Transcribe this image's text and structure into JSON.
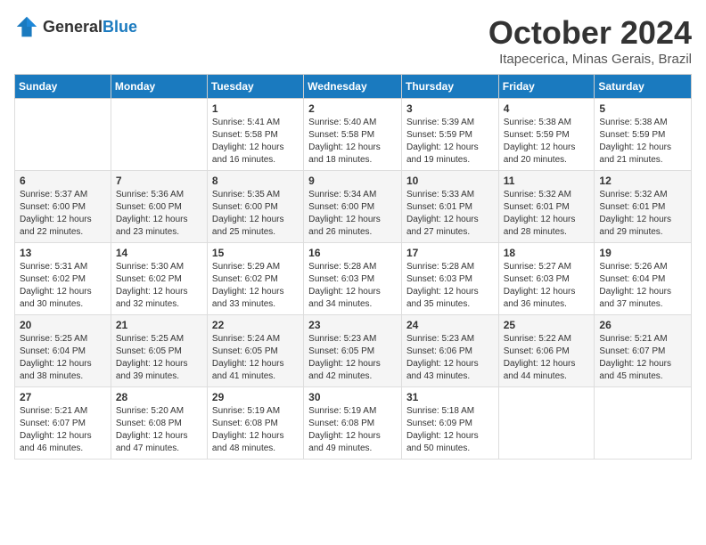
{
  "logo": {
    "general": "General",
    "blue": "Blue"
  },
  "title": "October 2024",
  "location": "Itapecerica, Minas Gerais, Brazil",
  "days_of_week": [
    "Sunday",
    "Monday",
    "Tuesday",
    "Wednesday",
    "Thursday",
    "Friday",
    "Saturday"
  ],
  "weeks": [
    [
      {
        "day": "",
        "sunrise": "",
        "sunset": "",
        "daylight": ""
      },
      {
        "day": "",
        "sunrise": "",
        "sunset": "",
        "daylight": ""
      },
      {
        "day": "1",
        "sunrise": "Sunrise: 5:41 AM",
        "sunset": "Sunset: 5:58 PM",
        "daylight": "Daylight: 12 hours and 16 minutes."
      },
      {
        "day": "2",
        "sunrise": "Sunrise: 5:40 AM",
        "sunset": "Sunset: 5:58 PM",
        "daylight": "Daylight: 12 hours and 18 minutes."
      },
      {
        "day": "3",
        "sunrise": "Sunrise: 5:39 AM",
        "sunset": "Sunset: 5:59 PM",
        "daylight": "Daylight: 12 hours and 19 minutes."
      },
      {
        "day": "4",
        "sunrise": "Sunrise: 5:38 AM",
        "sunset": "Sunset: 5:59 PM",
        "daylight": "Daylight: 12 hours and 20 minutes."
      },
      {
        "day": "5",
        "sunrise": "Sunrise: 5:38 AM",
        "sunset": "Sunset: 5:59 PM",
        "daylight": "Daylight: 12 hours and 21 minutes."
      }
    ],
    [
      {
        "day": "6",
        "sunrise": "Sunrise: 5:37 AM",
        "sunset": "Sunset: 6:00 PM",
        "daylight": "Daylight: 12 hours and 22 minutes."
      },
      {
        "day": "7",
        "sunrise": "Sunrise: 5:36 AM",
        "sunset": "Sunset: 6:00 PM",
        "daylight": "Daylight: 12 hours and 23 minutes."
      },
      {
        "day": "8",
        "sunrise": "Sunrise: 5:35 AM",
        "sunset": "Sunset: 6:00 PM",
        "daylight": "Daylight: 12 hours and 25 minutes."
      },
      {
        "day": "9",
        "sunrise": "Sunrise: 5:34 AM",
        "sunset": "Sunset: 6:00 PM",
        "daylight": "Daylight: 12 hours and 26 minutes."
      },
      {
        "day": "10",
        "sunrise": "Sunrise: 5:33 AM",
        "sunset": "Sunset: 6:01 PM",
        "daylight": "Daylight: 12 hours and 27 minutes."
      },
      {
        "day": "11",
        "sunrise": "Sunrise: 5:32 AM",
        "sunset": "Sunset: 6:01 PM",
        "daylight": "Daylight: 12 hours and 28 minutes."
      },
      {
        "day": "12",
        "sunrise": "Sunrise: 5:32 AM",
        "sunset": "Sunset: 6:01 PM",
        "daylight": "Daylight: 12 hours and 29 minutes."
      }
    ],
    [
      {
        "day": "13",
        "sunrise": "Sunrise: 5:31 AM",
        "sunset": "Sunset: 6:02 PM",
        "daylight": "Daylight: 12 hours and 30 minutes."
      },
      {
        "day": "14",
        "sunrise": "Sunrise: 5:30 AM",
        "sunset": "Sunset: 6:02 PM",
        "daylight": "Daylight: 12 hours and 32 minutes."
      },
      {
        "day": "15",
        "sunrise": "Sunrise: 5:29 AM",
        "sunset": "Sunset: 6:02 PM",
        "daylight": "Daylight: 12 hours and 33 minutes."
      },
      {
        "day": "16",
        "sunrise": "Sunrise: 5:28 AM",
        "sunset": "Sunset: 6:03 PM",
        "daylight": "Daylight: 12 hours and 34 minutes."
      },
      {
        "day": "17",
        "sunrise": "Sunrise: 5:28 AM",
        "sunset": "Sunset: 6:03 PM",
        "daylight": "Daylight: 12 hours and 35 minutes."
      },
      {
        "day": "18",
        "sunrise": "Sunrise: 5:27 AM",
        "sunset": "Sunset: 6:03 PM",
        "daylight": "Daylight: 12 hours and 36 minutes."
      },
      {
        "day": "19",
        "sunrise": "Sunrise: 5:26 AM",
        "sunset": "Sunset: 6:04 PM",
        "daylight": "Daylight: 12 hours and 37 minutes."
      }
    ],
    [
      {
        "day": "20",
        "sunrise": "Sunrise: 5:25 AM",
        "sunset": "Sunset: 6:04 PM",
        "daylight": "Daylight: 12 hours and 38 minutes."
      },
      {
        "day": "21",
        "sunrise": "Sunrise: 5:25 AM",
        "sunset": "Sunset: 6:05 PM",
        "daylight": "Daylight: 12 hours and 39 minutes."
      },
      {
        "day": "22",
        "sunrise": "Sunrise: 5:24 AM",
        "sunset": "Sunset: 6:05 PM",
        "daylight": "Daylight: 12 hours and 41 minutes."
      },
      {
        "day": "23",
        "sunrise": "Sunrise: 5:23 AM",
        "sunset": "Sunset: 6:05 PM",
        "daylight": "Daylight: 12 hours and 42 minutes."
      },
      {
        "day": "24",
        "sunrise": "Sunrise: 5:23 AM",
        "sunset": "Sunset: 6:06 PM",
        "daylight": "Daylight: 12 hours and 43 minutes."
      },
      {
        "day": "25",
        "sunrise": "Sunrise: 5:22 AM",
        "sunset": "Sunset: 6:06 PM",
        "daylight": "Daylight: 12 hours and 44 minutes."
      },
      {
        "day": "26",
        "sunrise": "Sunrise: 5:21 AM",
        "sunset": "Sunset: 6:07 PM",
        "daylight": "Daylight: 12 hours and 45 minutes."
      }
    ],
    [
      {
        "day": "27",
        "sunrise": "Sunrise: 5:21 AM",
        "sunset": "Sunset: 6:07 PM",
        "daylight": "Daylight: 12 hours and 46 minutes."
      },
      {
        "day": "28",
        "sunrise": "Sunrise: 5:20 AM",
        "sunset": "Sunset: 6:08 PM",
        "daylight": "Daylight: 12 hours and 47 minutes."
      },
      {
        "day": "29",
        "sunrise": "Sunrise: 5:19 AM",
        "sunset": "Sunset: 6:08 PM",
        "daylight": "Daylight: 12 hours and 48 minutes."
      },
      {
        "day": "30",
        "sunrise": "Sunrise: 5:19 AM",
        "sunset": "Sunset: 6:08 PM",
        "daylight": "Daylight: 12 hours and 49 minutes."
      },
      {
        "day": "31",
        "sunrise": "Sunrise: 5:18 AM",
        "sunset": "Sunset: 6:09 PM",
        "daylight": "Daylight: 12 hours and 50 minutes."
      },
      {
        "day": "",
        "sunrise": "",
        "sunset": "",
        "daylight": ""
      },
      {
        "day": "",
        "sunrise": "",
        "sunset": "",
        "daylight": ""
      }
    ]
  ]
}
